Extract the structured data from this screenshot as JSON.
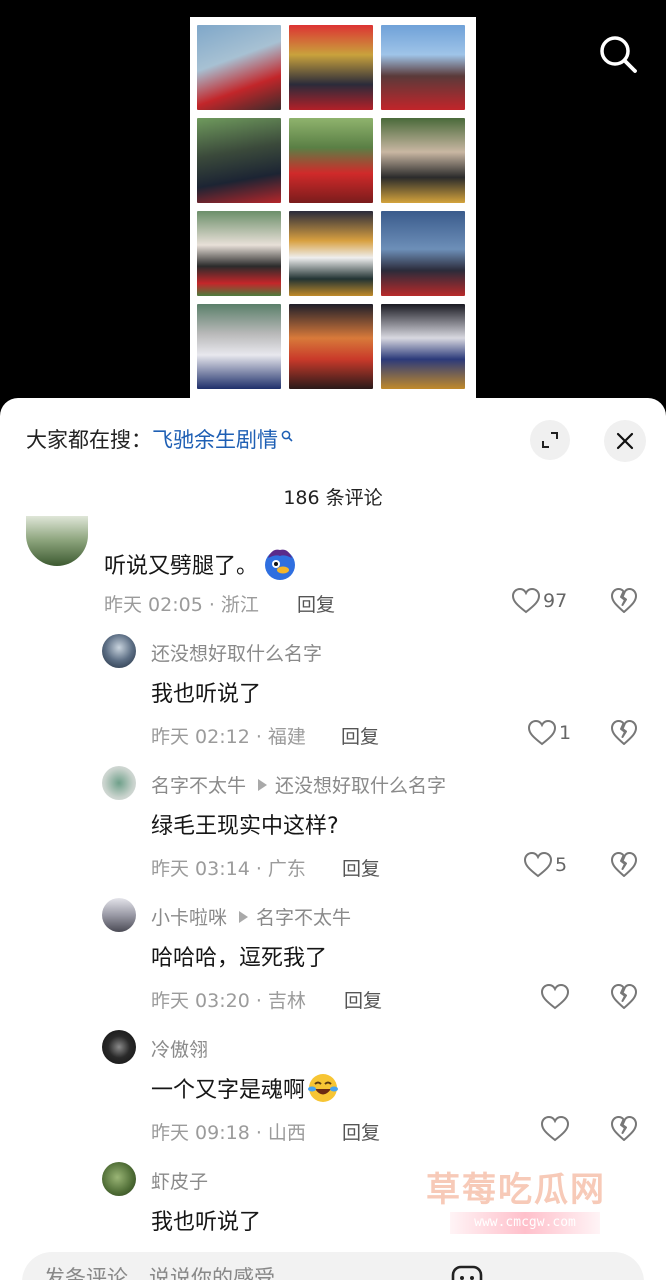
{
  "search_icon": "search-icon",
  "hot_search": {
    "prefix": "大家都在搜：",
    "term": "飞驰余生剧情"
  },
  "comment_count": "186 条评论",
  "comments": [
    {
      "user": "",
      "text": "听说又劈腿了。",
      "emoji": "blue-bird-emoji",
      "time_location": "昨天 02:05 · 浙江",
      "reply_label": "回复",
      "likes": "97"
    },
    {
      "user": "还没想好取什么名字",
      "reply_to": "",
      "text": "我也听说了",
      "time_location": "昨天 02:12 · 福建",
      "reply_label": "回复",
      "likes": "1"
    },
    {
      "user": "名字不太牛",
      "reply_to": "还没想好取什么名字",
      "text": "绿毛王现实中这样?",
      "time_location": "昨天 03:14 · 广东",
      "reply_label": "回复",
      "likes": "5"
    },
    {
      "user": "小卡啦咪",
      "reply_to": "名字不太牛",
      "text": "哈哈哈，逗死我了",
      "time_location": "昨天 03:20 · 吉林",
      "reply_label": "回复",
      "likes": ""
    },
    {
      "user": "冷傲翎",
      "reply_to": "",
      "text": "一个又字是魂啊",
      "emoji": "laugh-cry-emoji",
      "time_location": "昨天 09:18 · 山西",
      "reply_label": "回复",
      "likes": ""
    },
    {
      "user": "虾皮子",
      "reply_to": "",
      "text": "我也听说了",
      "time_location": "",
      "reply_label": "",
      "likes": ""
    }
  ],
  "watermark": {
    "text": "草莓吃瓜网",
    "url": "www.cmcgw.com"
  },
  "input": {
    "placeholder": "发条评论，说说你的感受"
  },
  "colors": {
    "link": "#1e5fb4",
    "sheet_bg": "#ffffff",
    "meta": "#9b9b9b"
  }
}
